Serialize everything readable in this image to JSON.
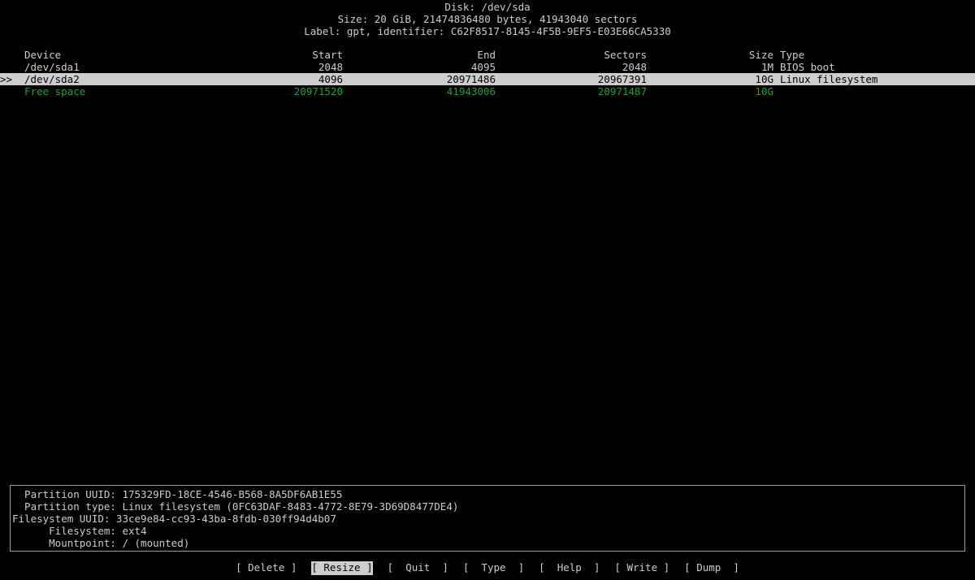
{
  "disk": {
    "title": "Disk: /dev/sda",
    "size_line": "Size: 20 GiB, 21474836480 bytes, 41943040 sectors",
    "label_line": "Label: gpt, identifier: C62F8517-8145-4F5B-9EF5-E03E66CA5330"
  },
  "table": {
    "headers": {
      "marker": "",
      "device": "Device",
      "start": "Start",
      "end": "End",
      "sectors": "Sectors",
      "size": "Size",
      "type": "Type"
    },
    "rows": [
      {
        "marker": "",
        "device": "/dev/sda1",
        "start": "2048",
        "end": "4095",
        "sectors": "2048",
        "size": "1M",
        "type": "BIOS boot",
        "selected": false,
        "free": false
      },
      {
        "marker": ">>",
        "device": "/dev/sda2",
        "start": "4096",
        "end": "20971486",
        "sectors": "20967391",
        "size": "10G",
        "type": "Linux filesystem",
        "selected": true,
        "free": false
      },
      {
        "marker": "",
        "device": "Free space",
        "start": "20971520",
        "end": "41943006",
        "sectors": "20971487",
        "size": "10G",
        "type": "",
        "selected": false,
        "free": true
      }
    ]
  },
  "info": {
    "lines": [
      "  Partition UUID: 175329FD-18CE-4546-B568-8A5DF6AB1E55",
      "  Partition type: Linux filesystem (0FC63DAF-8483-4772-8E79-3D69D8477DE4)",
      "Filesystem UUID: 33ce9e84-cc93-43ba-8fdb-030ff94d4b07",
      "      Filesystem: ext4",
      "      Mountpoint: / (mounted)"
    ]
  },
  "menu": {
    "buttons": [
      {
        "label": "[ Delete ]",
        "active": false
      },
      {
        "label": "[ Resize ]",
        "active": true
      },
      {
        "label": "[  Quit  ]",
        "active": false
      },
      {
        "label": "[  Type  ]",
        "active": false
      },
      {
        "label": "[  Help  ]",
        "active": false
      },
      {
        "label": "[ Write ]",
        "active": false
      },
      {
        "label": "[ Dump  ]",
        "active": false
      }
    ]
  },
  "colors": {
    "background": "#000000",
    "foreground": "#cccccc",
    "highlight_bg": "#cdcdcd",
    "highlight_fg": "#000000",
    "free_space_green": "#1f9e2e",
    "border": "#9a9a9a"
  }
}
